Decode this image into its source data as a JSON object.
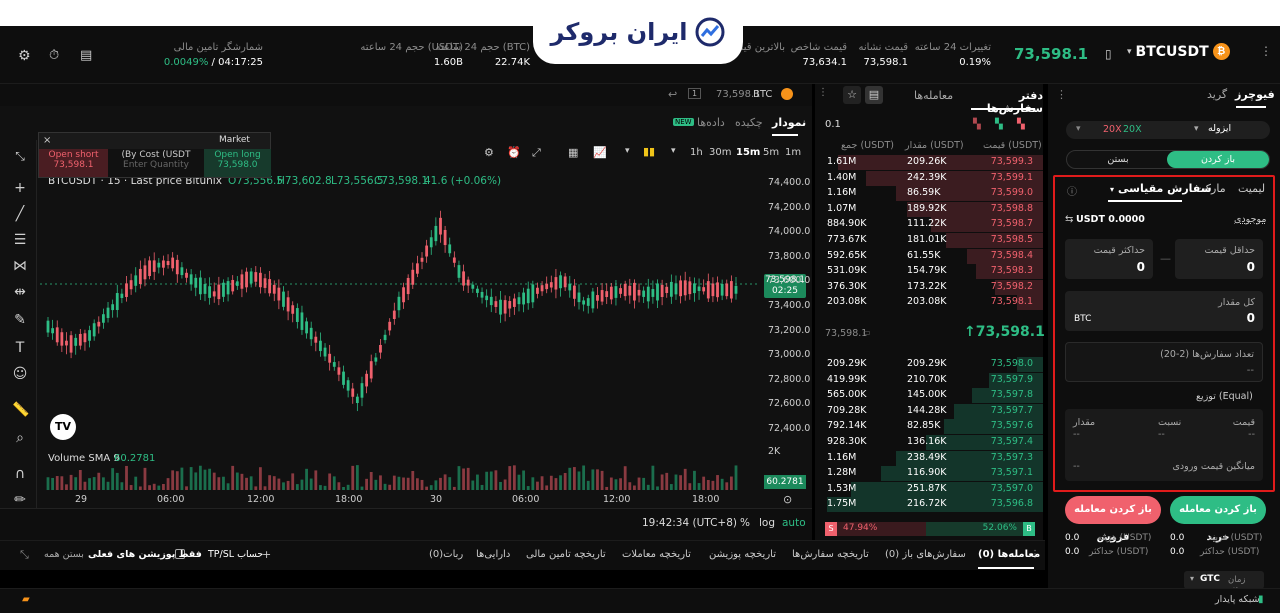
{
  "brand": {
    "name": "ایران بروکر"
  },
  "header": {
    "symbol": "BTCUSDT",
    "last_price": "73,598.1",
    "stats": [
      {
        "label": "تغییرات 24 ساعته",
        "value": "0.19%",
        "color": "green"
      },
      {
        "label": "قیمت نشانه",
        "value": "73,598.1",
        "color": "white"
      },
      {
        "label": "قیمت شاخص",
        "value": "73,634.1",
        "color": "white"
      },
      {
        "label": "بالاترین قیمت",
        "value": "",
        "color": "white"
      },
      {
        "label": "(BTC) حجم 24 ساعته",
        "value": "22.74K",
        "color": "white"
      },
      {
        "label": "(USDT) حجم 24 ساعته",
        "value": "1.60B",
        "color": "white"
      },
      {
        "label": "شمارشگر تامین مالی",
        "value": "04:17:25 / ",
        "value2": "0.0049%"
      }
    ]
  },
  "chart": {
    "tabs": [
      "نمودار",
      "چکیده",
      "داده‌ها"
    ],
    "new_badge": "NEW",
    "topbar_price": "73,598.1",
    "topbar_symbol": "BTC",
    "timeframes": [
      "1m",
      "5m",
      "15m",
      "30m",
      "1h"
    ],
    "active_tf": "15m",
    "legend": "BTCUSDT · 15 · Last price Bitunix",
    "ohlc": {
      "o": "O73,556.5",
      "h": "H73,602.8",
      "l": "L73,556.5",
      "c": "C73,598.1",
      "chg": "41.6 (+0.06%)"
    },
    "trade_widget": {
      "market_label": "Market",
      "open_short": "Open short",
      "short_price": "73,598.1",
      "by_cost": "(By Cost (USDT",
      "enter_qty": "Enter Quantity",
      "open_long": "Open long",
      "long_price": "73,598.0"
    },
    "y_ticks": [
      "74,400.0",
      "74,200.0",
      "74,000.0",
      "73,800.0",
      "73,600.0",
      "73,400.0",
      "73,200.0",
      "73,000.0",
      "72,800.0",
      "72,600.0",
      "72,400.0"
    ],
    "price_tag": "73,598.1",
    "price_timer": "02:25",
    "volume_label": "Volume SMA 9",
    "volume_value": "60.2781",
    "volume_tag": "60.2781",
    "vol_axis": "2K",
    "x_ticks": [
      "29",
      "06:00",
      "12:00",
      "18:00",
      "30",
      "06:00",
      "12:00",
      "18:00"
    ],
    "clock": "19:42:34 (UTC+8)",
    "pct": "%",
    "log": "log",
    "auto": "auto",
    "tv_logo": "TV"
  },
  "orderbook": {
    "tabs": [
      "دفتر سفارش‌ها",
      "معامله‌ها"
    ],
    "tick": "0.1",
    "headers": [
      "جمع (USDT)",
      "مقدار (USDT)",
      "قیمت (USDT)"
    ],
    "asks": [
      {
        "total": "1.61M",
        "amount": "209.26K",
        "price": "73,599.3",
        "depth": 0.95
      },
      {
        "total": "1.40M",
        "amount": "242.39K",
        "price": "73,599.1",
        "depth": 0.82
      },
      {
        "total": "1.16M",
        "amount": "86.59K",
        "price": "73,599.0",
        "depth": 0.68
      },
      {
        "total": "1.07M",
        "amount": "189.92K",
        "price": "73,598.8",
        "depth": 0.63
      },
      {
        "total": "884.90K",
        "amount": "111.22K",
        "price": "73,598.7",
        "depth": 0.52
      },
      {
        "total": "773.67K",
        "amount": "181.01K",
        "price": "73,598.5",
        "depth": 0.45
      },
      {
        "total": "592.65K",
        "amount": "61.55K",
        "price": "73,598.4",
        "depth": 0.35
      },
      {
        "total": "531.09K",
        "amount": "154.79K",
        "price": "73,598.3",
        "depth": 0.31
      },
      {
        "total": "376.30K",
        "amount": "173.22K",
        "price": "73,598.2",
        "depth": 0.22
      },
      {
        "total": "203.08K",
        "amount": "203.08K",
        "price": "73,598.1",
        "depth": 0.12
      }
    ],
    "mid_price": "73,598.1",
    "mark_price": "73,598.1",
    "bids": [
      {
        "total": "209.29K",
        "amount": "209.29K",
        "price": "73,598.0",
        "depth": 0.12
      },
      {
        "total": "419.99K",
        "amount": "210.70K",
        "price": "73,597.9",
        "depth": 0.25
      },
      {
        "total": "565.00K",
        "amount": "145.00K",
        "price": "73,597.8",
        "depth": 0.33
      },
      {
        "total": "709.28K",
        "amount": "144.28K",
        "price": "73,597.7",
        "depth": 0.41
      },
      {
        "total": "792.14K",
        "amount": "82.85K",
        "price": "73,597.6",
        "depth": 0.46
      },
      {
        "total": "928.30K",
        "amount": "136.16K",
        "price": "73,597.4",
        "depth": 0.54
      },
      {
        "total": "1.16M",
        "amount": "238.49K",
        "price": "73,597.3",
        "depth": 0.68
      },
      {
        "total": "1.28M",
        "amount": "116.90K",
        "price": "73,597.1",
        "depth": 0.75
      },
      {
        "total": "1.53M",
        "amount": "251.87K",
        "price": "73,597.0",
        "depth": 0.89
      },
      {
        "total": "1.75M",
        "amount": "216.72K",
        "price": "73,596.8",
        "depth": 1.0
      }
    ],
    "ratio_sell": "47.94%",
    "ratio_buy": "52.06%",
    "ratio_buy_fraction": 0.5206,
    "sell_letter": "S",
    "buy_letter": "B"
  },
  "order": {
    "tabs": [
      "فیوچرز",
      "گرید"
    ],
    "margin_mode": "ایزوله",
    "leverage_left": "20X",
    "leverage_right": "20X",
    "open_tab": "باز کردن",
    "close_tab": "بستن",
    "order_types": [
      "لیمیت",
      "مارکت",
      "سفارش مقیاسی"
    ],
    "balance_label": "موجودی",
    "balance_value": "USDT 0.0000",
    "min_price_label": "حداقل قیمت",
    "min_price_value": "0",
    "max_price_label": "حداکثر قیمت",
    "max_price_value": "0",
    "dash": "—",
    "total_qty_label": "کل مقدار",
    "total_qty_value": "0",
    "qty_unit": "BTC",
    "order_count_label": "تعداد سفارش‌ها (2-20)",
    "order_count_value": "--",
    "distribution_label": "توزیع (Equal)",
    "dist_headers": [
      "قیمت",
      "نسبت",
      "مقدار"
    ],
    "dist_values": [
      "--",
      "--",
      "--"
    ],
    "avg_entry_label": "میانگین قیمت ورودی",
    "avg_entry_value": "--",
    "buy_button": "باز کردن معامله خرید",
    "sell_button": "باز کردن معامله فروش",
    "cost_label": "هزینه (USDT)",
    "cost_value": "0.0",
    "max_label": "حداکثر (USDT)",
    "max_value": "0.0",
    "tif_label": "زمان مؤثر",
    "tif_value": "GTC"
  },
  "bottom": {
    "tabs": [
      "معامله‌ها (0)",
      "سفارش‌های باز (0)",
      "تاریخچه سفارش‌ها",
      "تاریخچه پوزیشن",
      "تاریخچه معاملات",
      "تاریخچه تامین مالی",
      "دارایی‌ها",
      "ربات(0)"
    ],
    "tpsl": "TP/SL حساب",
    "only_current": "فقط پوزیشن های فعلی",
    "close_all": "بستن همه"
  },
  "footer": {
    "network": "شبکه پایدار"
  },
  "colors": {
    "up": "#2ebd85",
    "down": "#f0616d",
    "frame": "#e01b1b",
    "accent_buy": "#2ebd85",
    "accent_sell": "#f0616d"
  }
}
